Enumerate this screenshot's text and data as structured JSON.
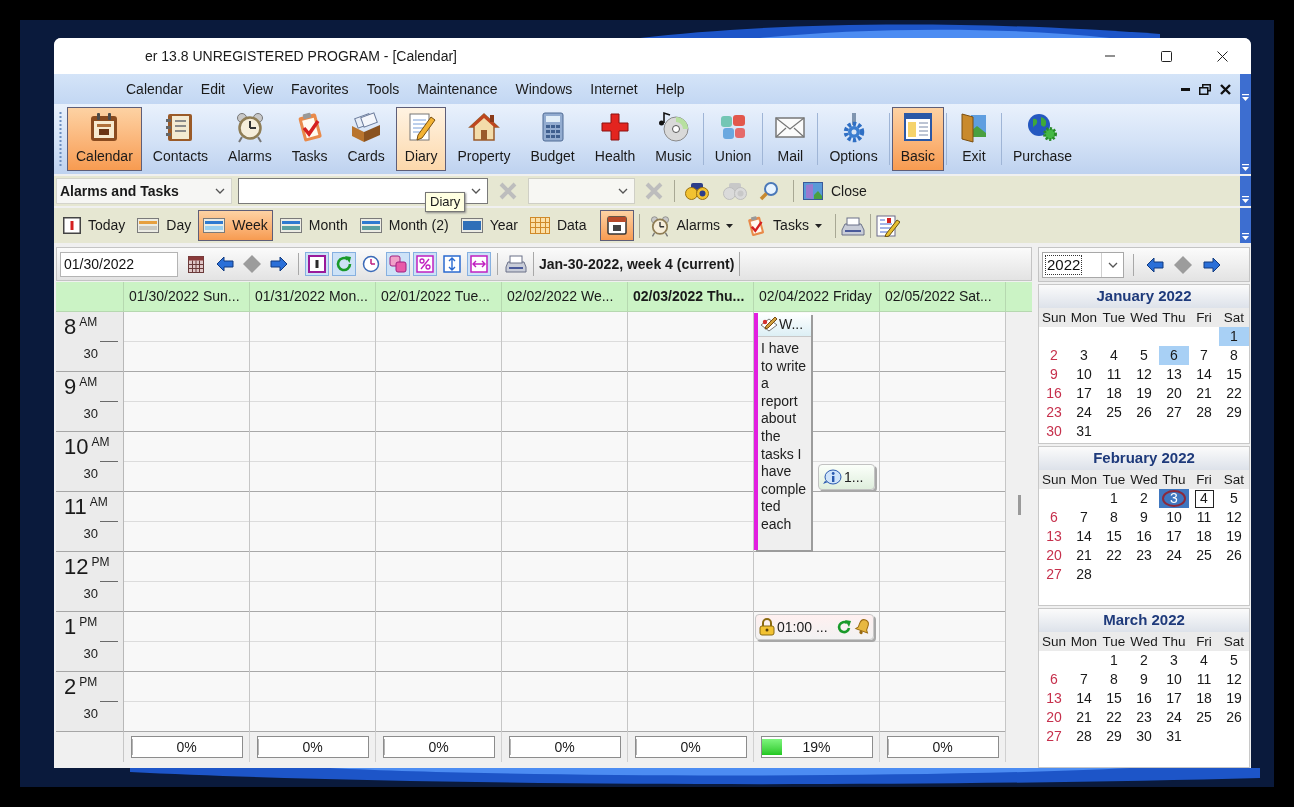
{
  "window": {
    "title": "er 13.8 UNREGISTERED PROGRAM - [Calendar]"
  },
  "menu": [
    "Calendar",
    "Edit",
    "View",
    "Favorites",
    "Tools",
    "Maintenance",
    "Windows",
    "Internet",
    "Help"
  ],
  "main_toolbar": [
    {
      "label": "Calendar",
      "selected": true,
      "hovered": false
    },
    {
      "label": "Contacts",
      "selected": false,
      "hovered": false
    },
    {
      "label": "Alarms",
      "selected": false,
      "hovered": false
    },
    {
      "label": "Tasks",
      "selected": false,
      "hovered": false
    },
    {
      "label": "Cards",
      "selected": false,
      "hovered": false
    },
    {
      "label": "Diary",
      "selected": false,
      "hovered": true
    },
    {
      "label": "Property",
      "selected": false,
      "hovered": false
    },
    {
      "label": "Budget",
      "selected": false,
      "hovered": false
    },
    {
      "label": "Health",
      "selected": false,
      "hovered": false
    },
    {
      "label": "Music",
      "selected": false,
      "hovered": false
    },
    {
      "label": "Union",
      "selected": false,
      "hovered": false
    },
    {
      "label": "Mail",
      "selected": false,
      "hovered": false
    },
    {
      "label": "Options",
      "selected": false,
      "hovered": false
    },
    {
      "label": "Basic",
      "selected": true,
      "hovered": false
    },
    {
      "label": "Exit",
      "selected": false,
      "hovered": false
    },
    {
      "label": "Purchase",
      "selected": false,
      "hovered": false
    }
  ],
  "filter_bar": {
    "category": "Alarms and Tasks",
    "tools": [
      {
        "disabled": true
      },
      {
        "disabled": true
      },
      {
        "disabled": false
      },
      {
        "disabled": true
      },
      {
        "disabled": false
      }
    ],
    "close_label": "Close"
  },
  "tooltip": {
    "text": "Diary"
  },
  "view_bar": {
    "views": [
      {
        "label": "Today",
        "selected": false
      },
      {
        "label": "Day",
        "selected": false
      },
      {
        "label": "Week",
        "selected": true
      },
      {
        "label": "Month",
        "selected": false
      },
      {
        "label": "Month (2)",
        "selected": false
      },
      {
        "label": "Year",
        "selected": false
      },
      {
        "label": "Data",
        "selected": false
      }
    ],
    "calendar_button": {
      "selected": true
    },
    "menus": [
      {
        "label": "Alarms"
      },
      {
        "label": "Tasks"
      }
    ]
  },
  "nav_bar": {
    "date": "01/30/2022",
    "toggles": [
      {
        "on": true
      },
      {
        "on": true
      },
      {
        "on": false
      },
      {
        "on": true
      },
      {
        "on": true
      },
      {
        "on": false
      },
      {
        "on": true
      }
    ],
    "caption": "Jan-30-2022, week 4 (current)"
  },
  "times": [
    {
      "hour": "8",
      "meridiem": "AM",
      "half": "30"
    },
    {
      "hour": "9",
      "meridiem": "AM",
      "half": "30"
    },
    {
      "hour": "10",
      "meridiem": "AM",
      "half": "30"
    },
    {
      "hour": "11",
      "meridiem": "AM",
      "half": "30"
    },
    {
      "hour": "12",
      "meridiem": "PM",
      "half": "30"
    },
    {
      "hour": "1",
      "meridiem": "PM",
      "half": "30"
    },
    {
      "hour": "2",
      "meridiem": "PM",
      "half": "30"
    }
  ],
  "days": [
    {
      "header": "01/30/2022 Sun...",
      "today": false,
      "progress": {
        "level": 0,
        "text": "0%"
      }
    },
    {
      "header": "01/31/2022 Mon...",
      "today": false,
      "progress": {
        "level": 0,
        "text": "0%"
      }
    },
    {
      "header": "02/01/2022 Tue...",
      "today": false,
      "progress": {
        "level": 0,
        "text": "0%"
      }
    },
    {
      "header": "02/02/2022 We...",
      "today": false,
      "progress": {
        "level": 0,
        "text": "0%"
      }
    },
    {
      "header": "02/03/2022 Thu...",
      "today": true,
      "progress": {
        "level": 0,
        "text": "0%"
      }
    },
    {
      "header": "02/04/2022 Friday",
      "today": false,
      "events": [
        {
          "kind": "diary",
          "title": "W...",
          "text": "I have to write a report about the tasks I have completed each",
          "color": "#e21ee0"
        },
        {
          "kind": "info",
          "title": "1..."
        },
        {
          "kind": "alarm",
          "title": "01:00 ..."
        }
      ],
      "progress": {
        "level": 0.19,
        "text": "19%"
      }
    },
    {
      "header": "02/05/2022 Sat...",
      "today": false,
      "progress": {
        "level": 0,
        "text": "0%"
      }
    }
  ],
  "mini_calendar": {
    "year": "2022",
    "months": [
      {
        "title": "January 2022",
        "weekdays": [
          "Sun",
          "Mon",
          "Tue",
          "Wed",
          "Thu",
          "Fri",
          "Sat"
        ],
        "weeks": [
          [
            {
              "day": "1",
              "selected": false,
              "kind": "marked"
            }
          ],
          [
            {
              "day": "2",
              "selected": false,
              "kind": "plain"
            },
            {
              "day": "3",
              "selected": false,
              "kind": "plain"
            },
            {
              "day": "4",
              "selected": false,
              "kind": "plain"
            },
            {
              "day": "5",
              "selected": false,
              "kind": "plain"
            },
            {
              "day": "6",
              "selected": false,
              "kind": "marked"
            },
            {
              "day": "7",
              "selected": false,
              "kind": "plain"
            },
            {
              "day": "8",
              "selected": false,
              "kind": "plain"
            }
          ],
          [
            {
              "day": "9",
              "selected": false,
              "kind": "plain"
            },
            {
              "day": "10",
              "selected": false,
              "kind": "plain"
            },
            {
              "day": "11",
              "selected": false,
              "kind": "plain"
            },
            {
              "day": "12",
              "selected": false,
              "kind": "plain"
            },
            {
              "day": "13",
              "selected": false,
              "kind": "plain"
            },
            {
              "day": "14",
              "selected": false,
              "kind": "plain"
            },
            {
              "day": "15",
              "selected": false,
              "kind": "plain"
            }
          ],
          [
            {
              "day": "16",
              "selected": false,
              "kind": "plain"
            },
            {
              "day": "17",
              "selected": false,
              "kind": "plain"
            },
            {
              "day": "18",
              "selected": false,
              "kind": "plain"
            },
            {
              "day": "19",
              "selected": false,
              "kind": "plain"
            },
            {
              "day": "20",
              "selected": false,
              "kind": "plain"
            },
            {
              "day": "21",
              "selected": false,
              "kind": "plain"
            },
            {
              "day": "22",
              "selected": false,
              "kind": "plain"
            }
          ],
          [
            {
              "day": "23",
              "selected": false,
              "kind": "plain"
            },
            {
              "day": "24",
              "selected": false,
              "kind": "plain"
            },
            {
              "day": "25",
              "selected": false,
              "kind": "plain"
            },
            {
              "day": "26",
              "selected": false,
              "kind": "plain"
            },
            {
              "day": "27",
              "selected": false,
              "kind": "plain"
            },
            {
              "day": "28",
              "selected": false,
              "kind": "plain"
            },
            {
              "day": "29",
              "selected": false,
              "kind": "plain"
            }
          ],
          [
            {
              "day": "30",
              "selected": false,
              "kind": "plain"
            },
            {
              "day": "31",
              "selected": false,
              "kind": "plain"
            }
          ]
        ]
      },
      {
        "title": "February 2022",
        "weekdays": [
          "Sun",
          "Mon",
          "Tue",
          "Wed",
          "Thu",
          "Fri",
          "Sat"
        ],
        "weeks": [
          [
            {
              "day": "1",
              "selected": false,
              "kind": "plain"
            },
            {
              "day": "2",
              "selected": false,
              "kind": "plain"
            },
            {
              "day": "3",
              "selected": true,
              "kind": "today"
            },
            {
              "day": "4",
              "selected": false,
              "kind": "boxed"
            },
            {
              "day": "5",
              "selected": false,
              "kind": "plain"
            }
          ],
          [
            {
              "day": "6",
              "selected": false,
              "kind": "plain"
            },
            {
              "day": "7",
              "selected": false,
              "kind": "plain"
            },
            {
              "day": "8",
              "selected": false,
              "kind": "plain"
            },
            {
              "day": "9",
              "selected": false,
              "kind": "plain"
            },
            {
              "day": "10",
              "selected": false,
              "kind": "plain"
            },
            {
              "day": "11",
              "selected": false,
              "kind": "plain"
            },
            {
              "day": "12",
              "selected": false,
              "kind": "plain"
            }
          ],
          [
            {
              "day": "13",
              "selected": false,
              "kind": "plain"
            },
            {
              "day": "14",
              "selected": false,
              "kind": "plain"
            },
            {
              "day": "15",
              "selected": false,
              "kind": "plain"
            },
            {
              "day": "16",
              "selected": false,
              "kind": "plain"
            },
            {
              "day": "17",
              "selected": false,
              "kind": "plain"
            },
            {
              "day": "18",
              "selected": false,
              "kind": "plain"
            },
            {
              "day": "19",
              "selected": false,
              "kind": "plain"
            }
          ],
          [
            {
              "day": "20",
              "selected": false,
              "kind": "plain"
            },
            {
              "day": "21",
              "selected": false,
              "kind": "plain"
            },
            {
              "day": "22",
              "selected": false,
              "kind": "plain"
            },
            {
              "day": "23",
              "selected": false,
              "kind": "plain"
            },
            {
              "day": "24",
              "selected": false,
              "kind": "plain"
            },
            {
              "day": "25",
              "selected": false,
              "kind": "plain"
            },
            {
              "day": "26",
              "selected": false,
              "kind": "plain"
            }
          ],
          [
            {
              "day": "27",
              "selected": false,
              "kind": "plain"
            },
            {
              "day": "28",
              "selected": false,
              "kind": "plain"
            }
          ]
        ]
      },
      {
        "title": "March 2022",
        "weekdays": [
          "Sun",
          "Mon",
          "Tue",
          "Wed",
          "Thu",
          "Fri",
          "Sat"
        ],
        "weeks": [
          [
            {
              "day": "1",
              "selected": false,
              "kind": "plain"
            },
            {
              "day": "2",
              "selected": false,
              "kind": "plain"
            },
            {
              "day": "3",
              "selected": false,
              "kind": "plain"
            },
            {
              "day": "4",
              "selected": false,
              "kind": "plain"
            },
            {
              "day": "5",
              "selected": false,
              "kind": "plain"
            }
          ],
          [
            {
              "day": "6",
              "selected": false,
              "kind": "plain"
            },
            {
              "day": "7",
              "selected": false,
              "kind": "plain"
            },
            {
              "day": "8",
              "selected": false,
              "kind": "plain"
            },
            {
              "day": "9",
              "selected": false,
              "kind": "plain"
            },
            {
              "day": "10",
              "selected": false,
              "kind": "plain"
            },
            {
              "day": "11",
              "selected": false,
              "kind": "plain"
            },
            {
              "day": "12",
              "selected": false,
              "kind": "plain"
            }
          ],
          [
            {
              "day": "13",
              "selected": false,
              "kind": "plain"
            },
            {
              "day": "14",
              "selected": false,
              "kind": "plain"
            },
            {
              "day": "15",
              "selected": false,
              "kind": "plain"
            },
            {
              "day": "16",
              "selected": false,
              "kind": "plain"
            },
            {
              "day": "17",
              "selected": false,
              "kind": "plain"
            },
            {
              "day": "18",
              "selected": false,
              "kind": "plain"
            },
            {
              "day": "19",
              "selected": false,
              "kind": "plain"
            }
          ],
          [
            {
              "day": "20",
              "selected": false,
              "kind": "plain"
            },
            {
              "day": "21",
              "selected": false,
              "kind": "plain"
            },
            {
              "day": "22",
              "selected": false,
              "kind": "plain"
            },
            {
              "day": "23",
              "selected": false,
              "kind": "plain"
            },
            {
              "day": "24",
              "selected": false,
              "kind": "plain"
            },
            {
              "day": "25",
              "selected": false,
              "kind": "plain"
            },
            {
              "day": "26",
              "selected": false,
              "kind": "plain"
            }
          ],
          [
            {
              "day": "27",
              "selected": false,
              "kind": "plain"
            },
            {
              "day": "28",
              "selected": false,
              "kind": "plain"
            },
            {
              "day": "29",
              "selected": false,
              "kind": "plain"
            },
            {
              "day": "30",
              "selected": false,
              "kind": "plain"
            },
            {
              "day": "31",
              "selected": false,
              "kind": "plain"
            }
          ]
        ]
      }
    ]
  }
}
